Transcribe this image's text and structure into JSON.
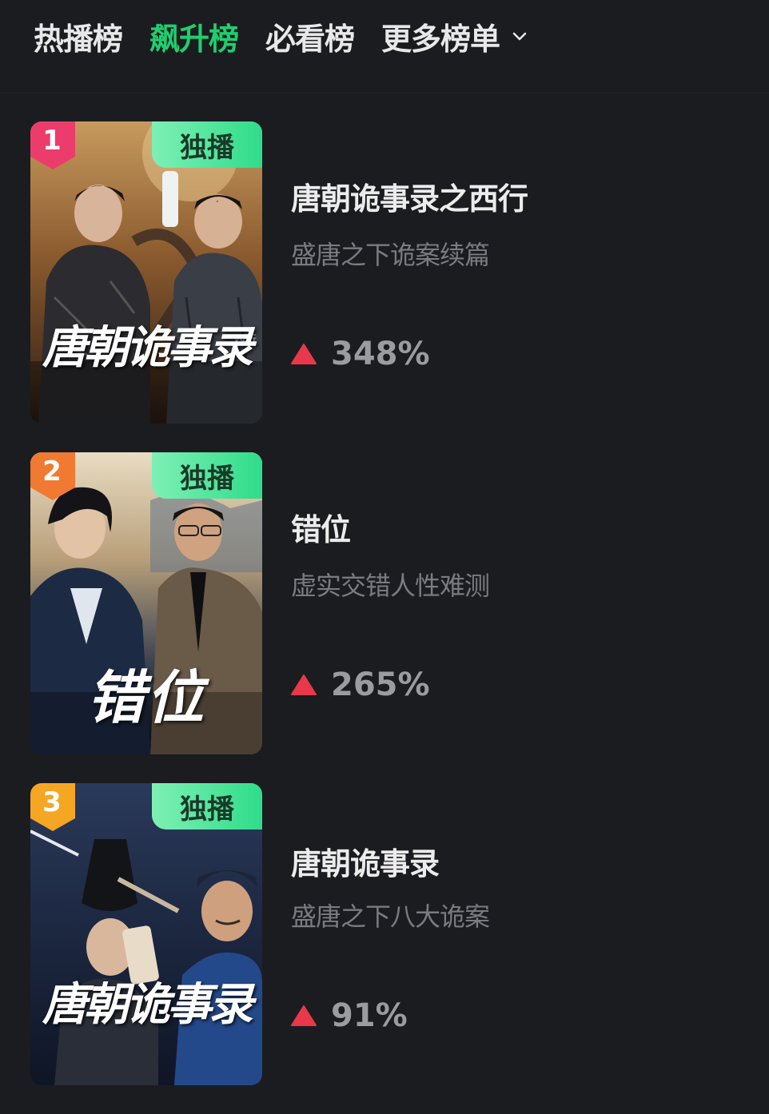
{
  "tabs": [
    {
      "label": "热播榜",
      "active": false
    },
    {
      "label": "飙升榜",
      "active": true
    },
    {
      "label": "必看榜",
      "active": false
    },
    {
      "label": "更多榜单",
      "active": false,
      "has_dropdown": true
    }
  ],
  "colors": {
    "active_tab": "#1fce6f",
    "background": "#1b1c20",
    "growth_up": "#e8384a",
    "badge": "#3fe08f"
  },
  "items": [
    {
      "rank": "1",
      "rank_color": "#ec3c6c",
      "badge": "独播",
      "poster_text": "唐朝诡事录",
      "title": "唐朝诡事录之西行",
      "subtitle": "盛唐之下诡案续篇",
      "growth": "348%"
    },
    {
      "rank": "2",
      "rank_color": "#f07a32",
      "badge": "独播",
      "poster_text": "错位",
      "title": "错位",
      "subtitle": "虚实交错人性难测",
      "growth": "265%"
    },
    {
      "rank": "3",
      "rank_color": "#f5a623",
      "badge": "独播",
      "poster_text": "唐朝诡事录",
      "title": "唐朝诡事录",
      "subtitle": "盛唐之下八大诡案",
      "growth": "91%"
    }
  ]
}
